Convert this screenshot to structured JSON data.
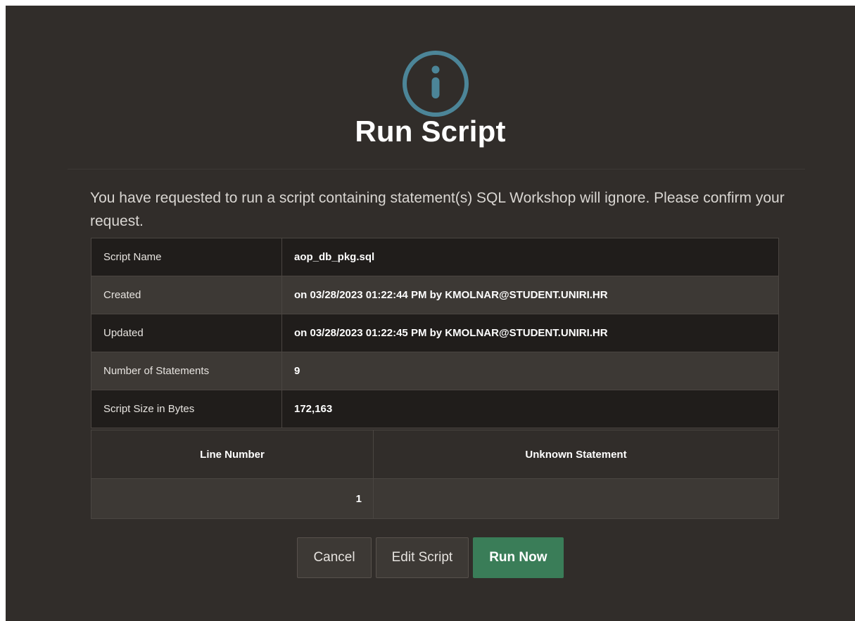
{
  "dialog": {
    "icon": "info-icon",
    "title": "Run Script",
    "message": "You have requested to run a script containing statement(s) SQL Workshop will ignore. Please confirm your request.",
    "colors": {
      "background": "#312d2a",
      "accent_icon": "#4c8598",
      "primary_button": "#3a7d58"
    }
  },
  "details": [
    {
      "label": "Script Name",
      "value": "aop_db_pkg.sql"
    },
    {
      "label": "Created",
      "value": "on 03/28/2023 01:22:44 PM by KMOLNAR@STUDENT.UNIRI.HR"
    },
    {
      "label": "Updated",
      "value": "on 03/28/2023 01:22:45 PM by KMOLNAR@STUDENT.UNIRI.HR"
    },
    {
      "label": "Number of Statements",
      "value": "9"
    },
    {
      "label": "Script Size in Bytes",
      "value": "172,163"
    }
  ],
  "statements": {
    "headers": [
      "Line Number",
      "Unknown Statement"
    ],
    "rows": [
      {
        "line": "1",
        "statement": ""
      }
    ]
  },
  "buttons": {
    "cancel": "Cancel",
    "edit": "Edit Script",
    "run": "Run Now"
  }
}
